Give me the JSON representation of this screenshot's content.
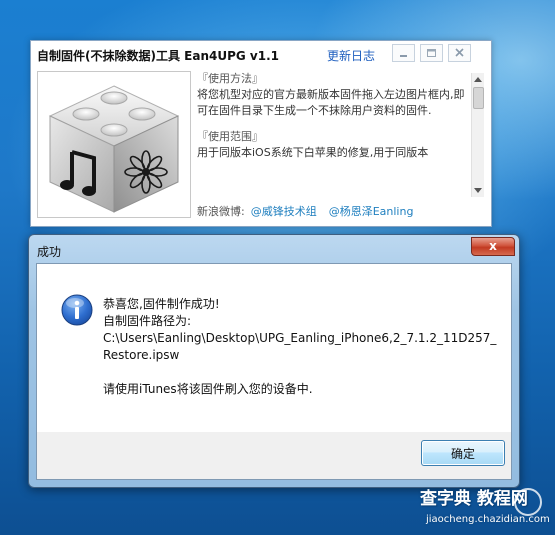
{
  "tool_window": {
    "title": "自制固件(不抹除数据)工具 Ean4UPG v1.1",
    "update_log_link": "更新日志",
    "usage_header": "『使用方法』",
    "usage_text": "将您机型对应的官方最新版本固件拖入左边图片框内,即可在固件目录下生成一个不抹除用户资料的固件.",
    "scope_header": "『使用范围』",
    "scope_text": "用于同版本iOS系统下白苹果的修复,用于同版本",
    "weibo_label": "新浪微博:",
    "weibo_links": [
      "@威锋技术组",
      "@杨恩泽Eanling"
    ],
    "icons": {
      "image_box": "itunes-iphone-icon",
      "minimize": "minimize-icon",
      "maximize": "maximize-icon",
      "close": "close-icon"
    }
  },
  "dialog": {
    "title": "成功",
    "close_glyph": "x",
    "icon": "info-icon",
    "message_lines": [
      "恭喜您,固件制作成功!",
      "自制固件路径为:",
      "C:\\Users\\Eanling\\Desktop\\UPG_Eanling_iPhone6,2_7.1.2_11D257_",
      "Restore.ipsw",
      "请使用iTunes将该固件刷入您的设备中."
    ],
    "ok_button": "确定"
  },
  "watermark": {
    "main": "查字典 教程网",
    "sub": "jiaocheng.chazidian.com"
  },
  "colors": {
    "link_blue": "#1f5fbf",
    "dialog_frame": "#9fc4e4",
    "close_red": "#c23a22",
    "desktop_blue": "#1e78c8"
  }
}
